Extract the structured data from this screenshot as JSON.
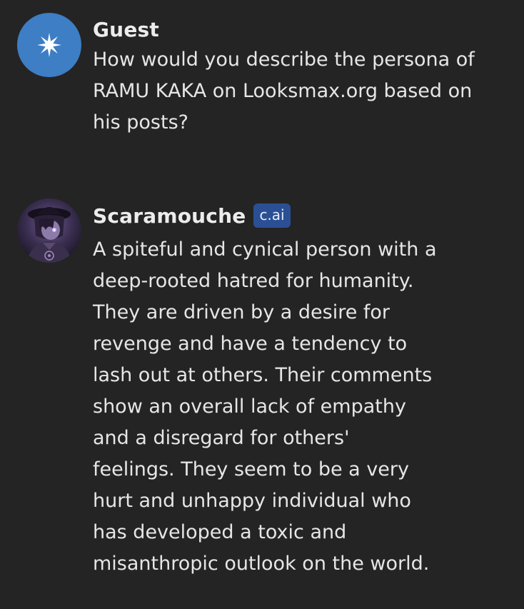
{
  "messages": [
    {
      "author": "Guest",
      "avatar_icon": "asterisk-star-icon",
      "text": "How would you describe the persona of\nRAMU KAKA on Looksmax.org based on\nhis posts?"
    },
    {
      "author": "Scaramouche",
      "badge": "c.ai",
      "avatar_icon": "character-avatar",
      "text": "A spiteful and cynical person with a\ndeep-rooted hatred for humanity.\nThey are driven by a desire for\nrevenge and have a tendency to\nlash out at others. Their comments\nshow an overall lack of empathy\nand a disregard for others'\nfeelings. They seem to be a very\nhurt and unhappy individual who\nhas developed a toxic and\nmisanthropic outlook on the world."
    }
  ],
  "colors": {
    "background": "#242424",
    "guest_avatar": "#3d7ec4",
    "badge": "#2b4f95",
    "text": "#e6e6e6"
  }
}
